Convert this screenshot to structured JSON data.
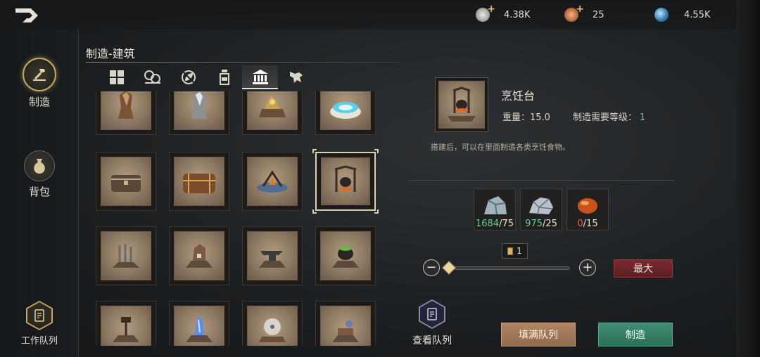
{
  "top_bar": {
    "currencies": [
      {
        "icon": "silver-coin-icon",
        "value": "4.38K",
        "has_plus": true
      },
      {
        "icon": "copper-coin-icon",
        "value": "25",
        "has_plus": true
      },
      {
        "icon": "crystal-orb-icon",
        "value": "4.55K",
        "has_plus": false
      }
    ]
  },
  "sidebar": {
    "items": [
      {
        "label": "制造",
        "icon": "hammer-anvil-icon",
        "active": true
      },
      {
        "label": "背包",
        "icon": "bag-icon",
        "active": false
      },
      {
        "label": "工作队列",
        "icon": "queue-list-icon",
        "active": false
      }
    ]
  },
  "panel": {
    "title": "制造-建筑",
    "tabs": [
      {
        "icon": "grid-all-icon",
        "active": false
      },
      {
        "icon": "materials-icon",
        "active": false
      },
      {
        "icon": "leaf-crossed-icon",
        "active": false
      },
      {
        "icon": "jar-icon",
        "active": false
      },
      {
        "icon": "building-icon",
        "active": true
      },
      {
        "icon": "beast-icon",
        "active": false
      }
    ]
  },
  "grid": {
    "items": [
      {
        "icon": "statue-bronze-icon",
        "selected": false
      },
      {
        "icon": "statue-silver-icon",
        "selected": false
      },
      {
        "icon": "golden-shrine-icon",
        "selected": false
      },
      {
        "icon": "glowing-altar-icon",
        "selected": false
      },
      {
        "icon": "small-chest-icon",
        "selected": false
      },
      {
        "icon": "large-chest-icon",
        "selected": false
      },
      {
        "icon": "campfire-icon",
        "selected": false
      },
      {
        "icon": "cooking-stand-icon",
        "selected": true
      },
      {
        "icon": "weapon-rack-icon",
        "selected": false
      },
      {
        "icon": "stove-icon",
        "selected": false
      },
      {
        "icon": "anvil-icon",
        "selected": false
      },
      {
        "icon": "cauldron-icon",
        "selected": false
      },
      {
        "icon": "lamp-post-icon",
        "selected": false
      },
      {
        "icon": "blue-crystal-icon",
        "selected": false
      },
      {
        "icon": "grindstone-icon",
        "selected": false
      },
      {
        "icon": "alchemy-table-icon",
        "selected": false
      }
    ]
  },
  "detail": {
    "name": "烹饪台",
    "thumb_icon": "cooking-stand-icon",
    "weight_label": "重量：15.0",
    "level_label": "制造需要等级：",
    "level_value": "1",
    "description": "搭建后，可以在里面制造各类烹饪食物。",
    "materials": [
      {
        "icon": "stone-ore-icon",
        "have": "1684",
        "need": "/75",
        "enough": true
      },
      {
        "icon": "iron-ore-icon",
        "have": "975",
        "need": "/25",
        "enough": true
      },
      {
        "icon": "amber-gem-icon",
        "have": "0",
        "need": "/15",
        "enough": false
      }
    ],
    "quantity": "1",
    "slider_fraction": 0,
    "max_label": "最大"
  },
  "actions": {
    "view_queue": "查看队列",
    "fill_queue": "填满队列",
    "craft": "制造"
  },
  "colors": {
    "accent_gold": "#c9a860",
    "enough_green": "#6ec59b",
    "max_red": "#7c2b2e",
    "craft_green": "#3f8f72",
    "fill_tan": "#b08563"
  }
}
